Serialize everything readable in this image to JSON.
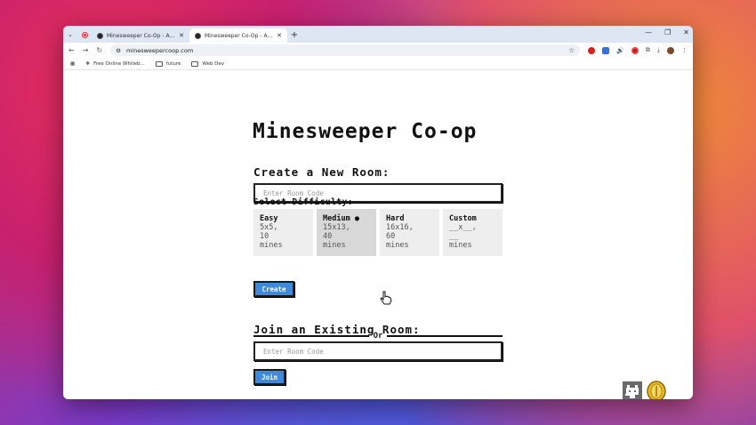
{
  "browser": {
    "tabs": [
      {
        "title": "Minesweeper Co-Op - An Onlin",
        "active": false
      },
      {
        "title": "Minesweeper Co-Op - An Onlin",
        "active": true
      }
    ],
    "url": "minesweepercoop.com",
    "bookmarks": [
      "Free Online Whiteb...",
      "future",
      "Web Dev"
    ]
  },
  "app": {
    "title": "Minesweeper Co-op",
    "create": {
      "heading": "Create a New Room:",
      "placeholder": "Enter Room Code",
      "difficulty_label": "Select Difficulty:",
      "difficulties": [
        {
          "name": "Easy",
          "l1": "5x5,",
          "l2": "10",
          "l3": "mines",
          "selected": false
        },
        {
          "name": "Medium ●",
          "l1": "15x13,",
          "l2": "40",
          "l3": "mines",
          "selected": true
        },
        {
          "name": "Hard",
          "l1": "16x16,",
          "l2": "60",
          "l3": "mines",
          "selected": false
        },
        {
          "name": "Custom",
          "l1": "__x__,",
          "l2": "__",
          "l3": "mines",
          "selected": false
        }
      ],
      "button": "Create"
    },
    "divider": "Or",
    "join": {
      "heading": "Join an Existing Room:",
      "placeholder": "Enter Room Code",
      "button": "Join"
    }
  },
  "colors": {
    "accent": "#3f8ad8",
    "tabbar": "#dfe6f3"
  }
}
